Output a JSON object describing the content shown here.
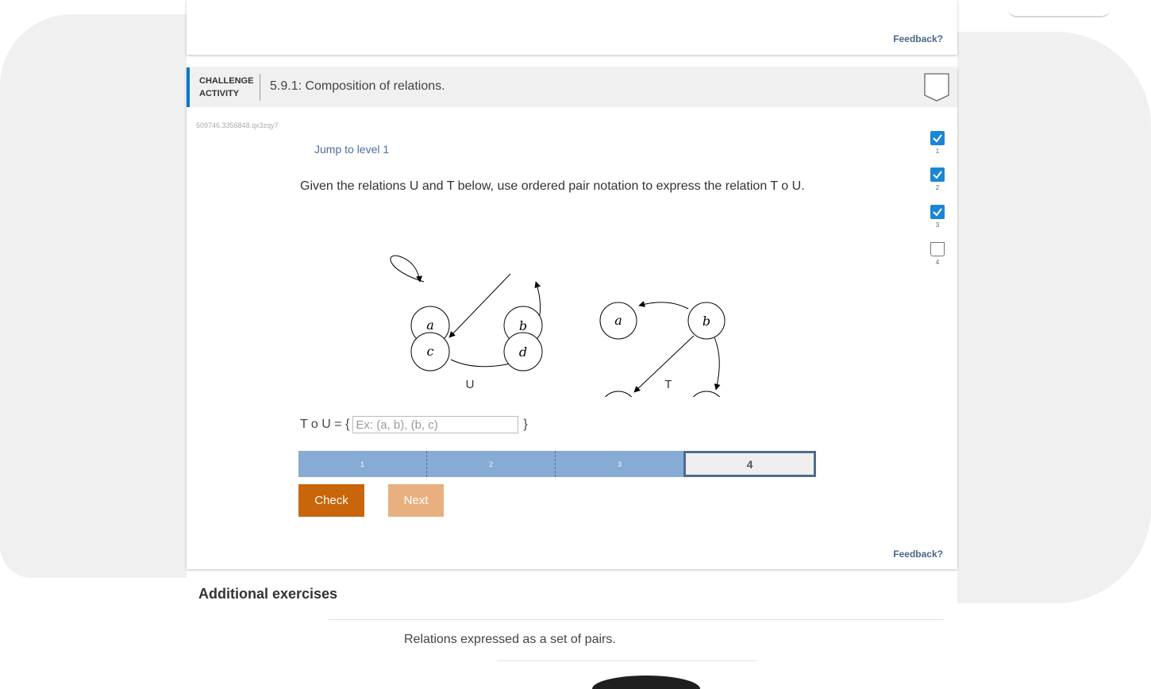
{
  "feedback_label": "Feedback?",
  "activity": {
    "type_line1": "CHALLENGE",
    "type_line2": "ACTIVITY",
    "title": "5.9.1: Composition of relations.",
    "id": "509746.3356848.qx3zqy7",
    "jump_label": "Jump to level 1",
    "prompt": "Given the relations U and T below, use ordered pair notation to express the relation T o U."
  },
  "graph": {
    "u_label": "U",
    "t_label": "T",
    "nodes": {
      "a": "a",
      "b": "b",
      "c": "c",
      "d": "d"
    }
  },
  "answer": {
    "prefix": "T o U = {",
    "placeholder": "Ex: (a, b), (b, c)",
    "value": "",
    "suffix": "}"
  },
  "levels": [
    {
      "label": "1",
      "status": "complete"
    },
    {
      "label": "2",
      "status": "complete"
    },
    {
      "label": "3",
      "status": "complete"
    },
    {
      "label": "4",
      "status": "current"
    }
  ],
  "buttons": {
    "check": "Check",
    "next": "Next"
  },
  "progress": [
    {
      "label": "1",
      "done": true
    },
    {
      "label": "2",
      "done": true
    },
    {
      "label": "3",
      "done": true
    },
    {
      "label": "4",
      "done": false
    }
  ],
  "below": {
    "heading": "Additional exercises",
    "text": "Relations expressed as a set of pairs."
  },
  "colors": {
    "accent": "#0a77c9",
    "check_button": "#c9650a",
    "next_button": "#e8b07f",
    "level_complete": "#86abd4"
  }
}
